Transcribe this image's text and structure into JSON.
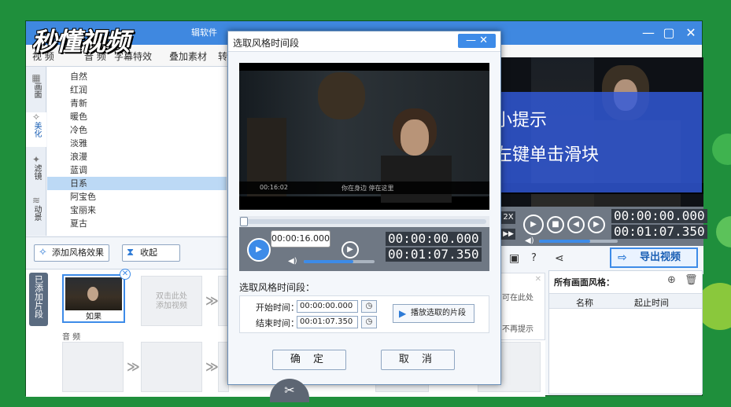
{
  "watermark": "秒懂视频",
  "app": {
    "title_partial": "辑软件",
    "menu": [
      "视 频",
      "音 频",
      "字幕特效",
      "叠加素材",
      "转"
    ],
    "window_controls": [
      "—",
      "▢",
      "✕"
    ]
  },
  "sidebar_tabs": [
    {
      "label": "画面",
      "icon": "▦"
    },
    {
      "label": "美化",
      "icon": "✧"
    },
    {
      "label": "滤镜",
      "icon": "✦"
    },
    {
      "label": "动景",
      "icon": "≋"
    }
  ],
  "style_list": [
    "自然",
    "红润",
    "青新",
    "暖色",
    "冷色",
    "淡雅",
    "浪漫",
    "蓝调",
    "日系",
    "阿宝色",
    "宝丽来",
    "夏古"
  ],
  "style_selected": "日系",
  "left_toolbar": {
    "add_style": "添加风格效果",
    "collapse": "收起"
  },
  "timeline": {
    "added_tab": "已添加片段",
    "clip_label": "如果",
    "empty_slot": "双击此处\n添加视频",
    "audio_label": "音 频"
  },
  "preview": {
    "tip_line1": "小提示",
    "tip_line2": "左键单击滑块",
    "speed": "2X",
    "time_current": "00:00:00.000",
    "time_total": "00:01:07.350",
    "volume_level": 0.65
  },
  "right_panel": {
    "export_label": "导出视频",
    "title": "所有画面风格：",
    "col_name": "名称",
    "col_time": "起止时间",
    "hint_line1": "可在此处",
    "hint_line2": "不再提示"
  },
  "dialog": {
    "title": "选取风格时间段",
    "close": "— ✕",
    "video_caption": "你在身边 停在这里",
    "video_time": "00:16:02",
    "hover_time": "00:00:16.000",
    "time_current": "00:00:00.000",
    "time_total": "00:01:07.350",
    "section_label": "选取风格时间段：",
    "start_label": "开始时间：",
    "start_value": "00:00:00.000",
    "end_label": "结束时间：",
    "end_value": "00:01:07.350",
    "play_selected": "播放选取的片段",
    "ok": "确 定",
    "cancel": "取 消",
    "progress_fraction": 0.0,
    "volume_level": 0.7
  },
  "scissor_icon": "✂"
}
